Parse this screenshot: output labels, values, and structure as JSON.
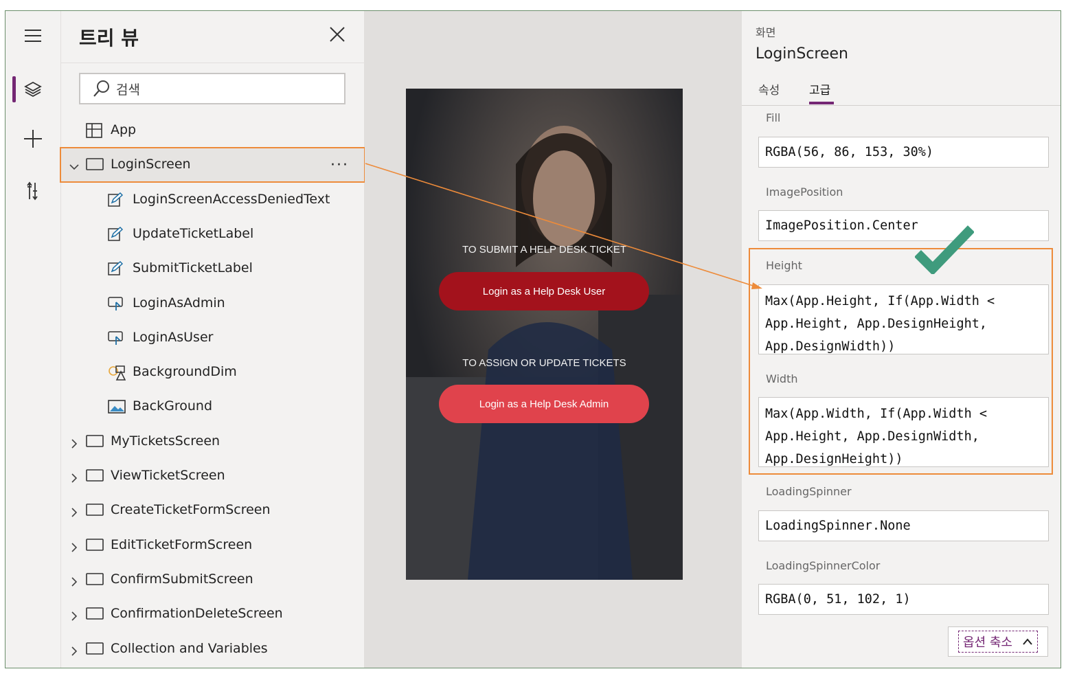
{
  "rail": {
    "icons": [
      "hamburger-menu-icon",
      "layers-icon",
      "plus-icon",
      "tools-icon"
    ]
  },
  "tree": {
    "title": "트리 뷰",
    "search_placeholder": "검색",
    "items": [
      {
        "label": "App",
        "icon": "app-icon"
      },
      {
        "label": "LoginScreen",
        "icon": "screen-icon",
        "expanded": true,
        "selected": true
      },
      {
        "label": "LoginScreenAccessDeniedText",
        "icon": "edit-label-icon"
      },
      {
        "label": "UpdateTicketLabel",
        "icon": "edit-label-icon"
      },
      {
        "label": "SubmitTicketLabel",
        "icon": "edit-label-icon"
      },
      {
        "label": "LoginAsAdmin",
        "icon": "button-icon"
      },
      {
        "label": "LoginAsUser",
        "icon": "button-icon"
      },
      {
        "label": "BackgroundDim",
        "icon": "shape-icon"
      },
      {
        "label": "BackGround",
        "icon": "image-icon"
      },
      {
        "label": "MyTicketsScreen",
        "icon": "screen-icon"
      },
      {
        "label": "ViewTicketScreen",
        "icon": "screen-icon"
      },
      {
        "label": "CreateTicketFormScreen",
        "icon": "screen-icon"
      },
      {
        "label": "EditTicketFormScreen",
        "icon": "screen-icon"
      },
      {
        "label": "ConfirmSubmitScreen",
        "icon": "screen-icon"
      },
      {
        "label": "ConfirmationDeleteScreen",
        "icon": "screen-icon"
      },
      {
        "label": "Collection and Variables",
        "icon": "screen-icon"
      }
    ]
  },
  "preview": {
    "submit_heading": "TO SUBMIT A HELP DESK TICKET",
    "user_button": "Login as a Help Desk User",
    "assign_heading": "TO ASSIGN OR UPDATE TICKETS",
    "admin_button": "Login as a Help Desk Admin",
    "user_button_color": "#a3121c",
    "admin_button_color": "#e0434c"
  },
  "props": {
    "kind": "화면",
    "name": "LoginScreen",
    "tabs": [
      "속성",
      "고급"
    ],
    "active_tab": "고급",
    "fields": [
      {
        "label": "Fill",
        "value": "RGBA(56, 86, 153, 30%)"
      },
      {
        "label": "ImagePosition",
        "value": "ImagePosition.Center"
      },
      {
        "label": "Height",
        "lines": [
          "Max(App.Height, If(App.Width <",
          "App.Height, App.DesignHeight,",
          "App.DesignWidth))"
        ]
      },
      {
        "label": "Width",
        "lines": [
          "Max(App.Width, If(App.Width <",
          "App.Height, App.DesignWidth,",
          "App.DesignHeight))"
        ]
      },
      {
        "label": "LoadingSpinner",
        "value": "LoadingSpinner.None"
      },
      {
        "label": "LoadingSpinnerColor",
        "value": "RGBA(0, 51, 102, 1)"
      }
    ],
    "collapse_label": "옵션 축소"
  },
  "colors": {
    "accent": "#742774",
    "highlight": "#ed8b3a",
    "check": "#3f9b7d"
  }
}
